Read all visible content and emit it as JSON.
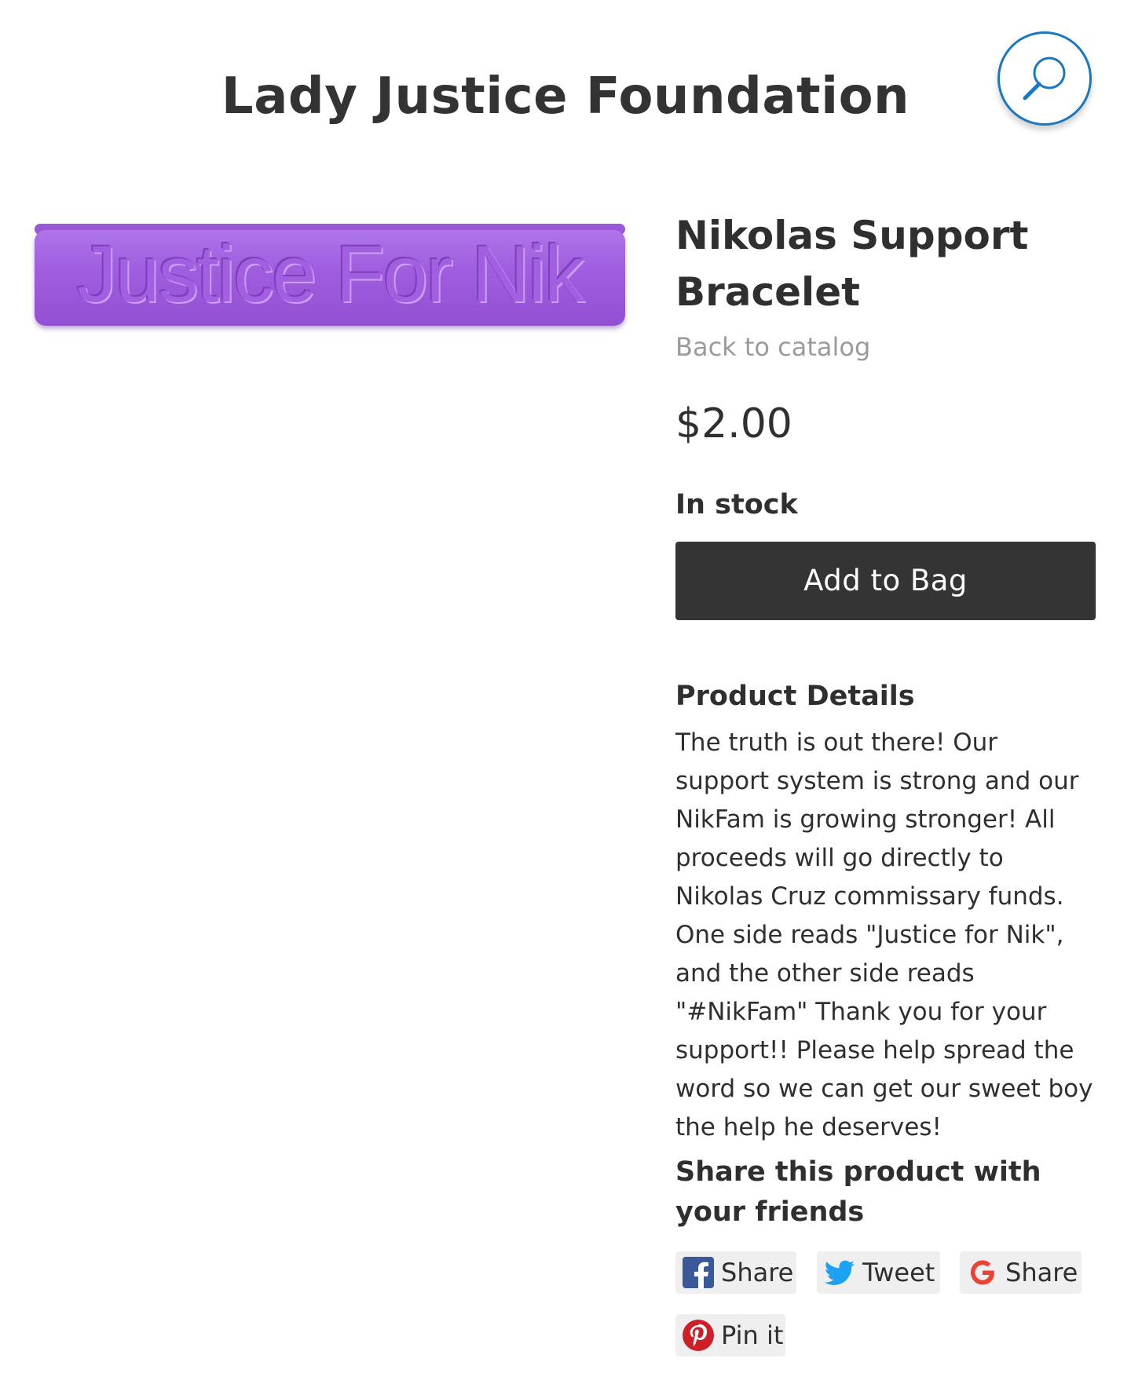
{
  "header": {
    "site_title": "Lady Justice Foundation",
    "search_icon": "search-icon",
    "accent_color": "#1b78c0"
  },
  "product": {
    "image_text": "Justice For Nik",
    "image_color": "#9f5cdf",
    "title": "Nikolas Support Bracelet",
    "back_link": "Back to catalog",
    "price": "$2.00",
    "stock_status": "In stock",
    "add_button_label": "Add to Bag"
  },
  "details": {
    "heading": "Product Details",
    "body": "The truth is out there! Our support system is strong and our NikFam is growing stronger! All proceeds will go directly to Nikolas Cruz commissary funds. One side reads \"Justice for Nik\", and the other side reads \"#NikFam\" Thank you for your support!! Please help spread the word so we can get our sweet boy the help he deserves!"
  },
  "share": {
    "heading": "Share this product with your friends",
    "buttons": [
      {
        "label": "Share",
        "icon": "facebook-icon",
        "color": "#3b5998"
      },
      {
        "label": "Tweet",
        "icon": "twitter-icon",
        "color": "#1da1f2"
      },
      {
        "label": "Share",
        "icon": "google-icon",
        "color": "#ea4335"
      },
      {
        "label": "Pin it",
        "icon": "pinterest-icon",
        "color": "#cb2027"
      }
    ]
  }
}
